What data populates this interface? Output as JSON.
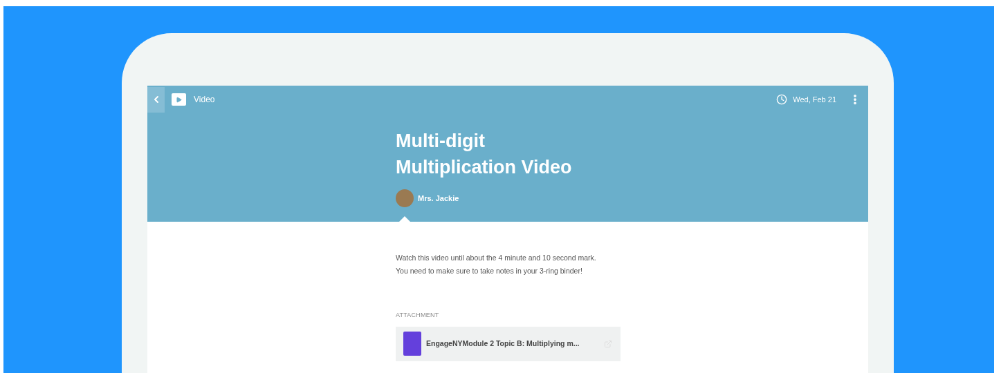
{
  "top_bar": {
    "type_label": "Video",
    "due_date": "Wed, Feb 21"
  },
  "assignment": {
    "title_lines": [
      "Multi-digit",
      "Multiplication Video"
    ],
    "author": "Mrs. Jackie"
  },
  "instructions": [
    "Watch this video until about the 4 minute and 10 second mark.",
    "You need to make sure to take notes in your 3-ring binder!"
  ],
  "attachment": {
    "heading": "ATTACHMENT",
    "file_name": "EngageNYModule 2 Topic B: Multiplying m..."
  }
}
